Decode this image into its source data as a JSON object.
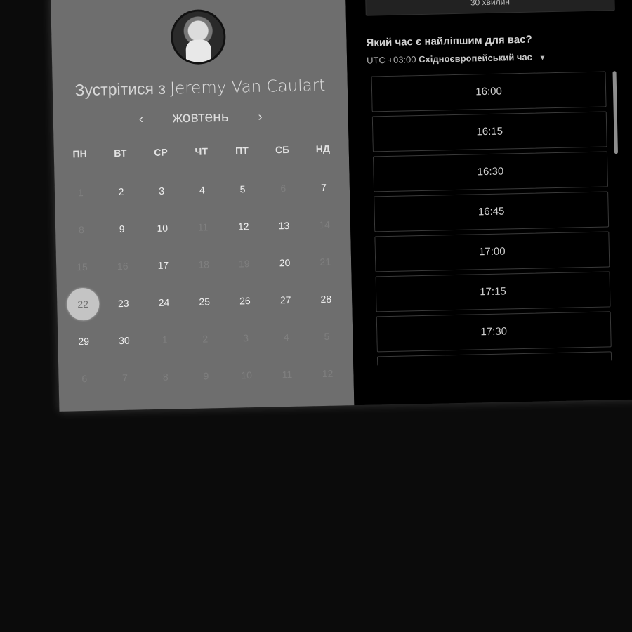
{
  "header": {
    "title_prefix": "Зустрітися з",
    "host_name": "Jeremy Van Caulart"
  },
  "calendar": {
    "month": "жовтень",
    "prev_icon": "chevron-left-icon",
    "next_icon": "chevron-right-icon",
    "prev_glyph": "‹",
    "next_glyph": "›",
    "weekdays": [
      "ПН",
      "ВТ",
      "СР",
      "ЧТ",
      "ПТ",
      "СБ",
      "НД"
    ],
    "selected_day": "22",
    "days": [
      {
        "label": "1",
        "state": "disabled"
      },
      {
        "label": "2",
        "state": "available"
      },
      {
        "label": "3",
        "state": "available"
      },
      {
        "label": "4",
        "state": "available"
      },
      {
        "label": "5",
        "state": "available"
      },
      {
        "label": "6",
        "state": "disabled"
      },
      {
        "label": "7",
        "state": "available"
      },
      {
        "label": "8",
        "state": "disabled"
      },
      {
        "label": "9",
        "state": "available"
      },
      {
        "label": "10",
        "state": "available"
      },
      {
        "label": "11",
        "state": "disabled"
      },
      {
        "label": "12",
        "state": "available"
      },
      {
        "label": "13",
        "state": "available"
      },
      {
        "label": "14",
        "state": "disabled"
      },
      {
        "label": "15",
        "state": "disabled"
      },
      {
        "label": "16",
        "state": "disabled"
      },
      {
        "label": "17",
        "state": "available"
      },
      {
        "label": "18",
        "state": "disabled"
      },
      {
        "label": "19",
        "state": "disabled"
      },
      {
        "label": "20",
        "state": "available"
      },
      {
        "label": "21",
        "state": "disabled"
      },
      {
        "label": "22",
        "state": "selected"
      },
      {
        "label": "23",
        "state": "available"
      },
      {
        "label": "24",
        "state": "available"
      },
      {
        "label": "25",
        "state": "available"
      },
      {
        "label": "26",
        "state": "available"
      },
      {
        "label": "27",
        "state": "available"
      },
      {
        "label": "28",
        "state": "available"
      },
      {
        "label": "29",
        "state": "available"
      },
      {
        "label": "30",
        "state": "available"
      },
      {
        "label": "1",
        "state": "disabled"
      },
      {
        "label": "2",
        "state": "disabled"
      },
      {
        "label": "3",
        "state": "disabled"
      },
      {
        "label": "4",
        "state": "disabled"
      },
      {
        "label": "5",
        "state": "disabled"
      },
      {
        "label": "6",
        "state": "disabled"
      },
      {
        "label": "7",
        "state": "disabled"
      },
      {
        "label": "8",
        "state": "disabled"
      },
      {
        "label": "9",
        "state": "disabled"
      },
      {
        "label": "10",
        "state": "disabled"
      },
      {
        "label": "11",
        "state": "disabled"
      },
      {
        "label": "12",
        "state": "disabled"
      }
    ]
  },
  "scheduler": {
    "duration": "30 хвилин",
    "question": "Який час є найліпшим для вас?",
    "timezone_offset": "UTC +03:00",
    "timezone_name": "Східноєвропейський час",
    "timezone_caret_icon": "caret-down-icon",
    "timezone_caret_glyph": "▼",
    "slots": [
      "16:00",
      "16:15",
      "16:30",
      "16:45",
      "17:00",
      "17:15",
      "17:30",
      ""
    ]
  },
  "colors": {
    "left_panel": "#6e6e6e",
    "right_panel": "#000000",
    "selected_day_bg": "#c4c4c4"
  }
}
